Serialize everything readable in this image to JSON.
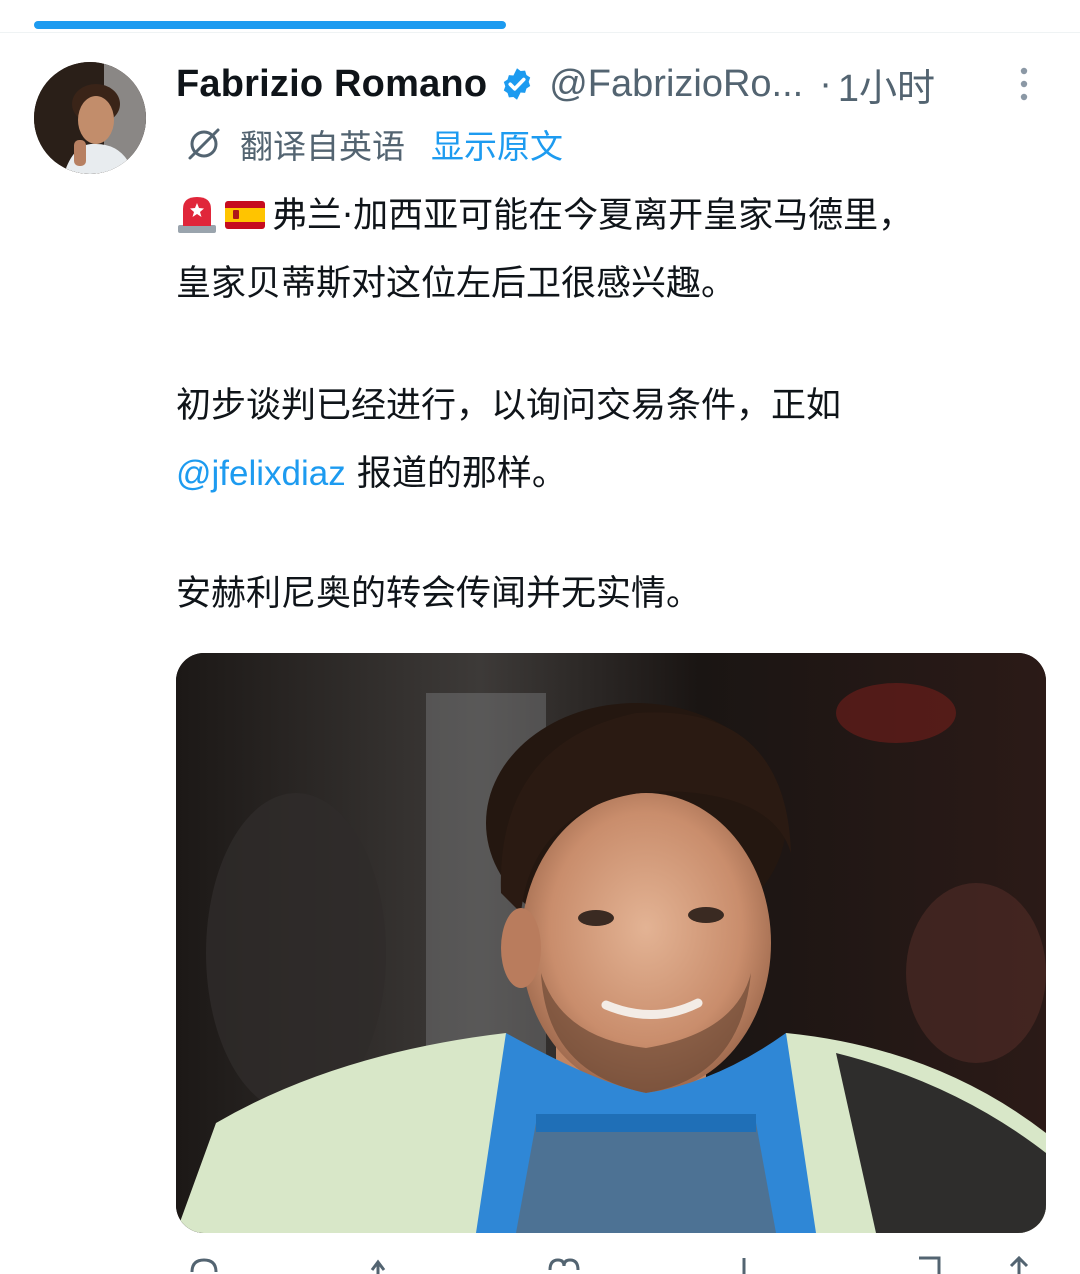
{
  "tweet": {
    "author_name": "Fabrizio Romano",
    "handle": "@FabrizioRo...",
    "separator": "·",
    "time": "1小时",
    "translation_label": "翻译自英语",
    "show_original_label": "显示原文",
    "paragraph1_line1": "弗兰·加西亚可能在今夏离开皇家马德里，",
    "paragraph1_line2": "皇家贝蒂斯对这位左后卫很感兴趣。",
    "paragraph2_line1": "初步谈判已经进行，以询问交易条件，正如",
    "paragraph2_mention": "@jfelixdiaz",
    "paragraph2_line2_rest": " 报道的那样。",
    "paragraph3": "安赫利尼奥的转会传闻并无实情。",
    "emojis": [
      "police-light",
      "spain-flag"
    ]
  },
  "colors": {
    "accent": "#1d9bf0",
    "secondary_text": "#536471",
    "primary_text": "#0f1419"
  }
}
